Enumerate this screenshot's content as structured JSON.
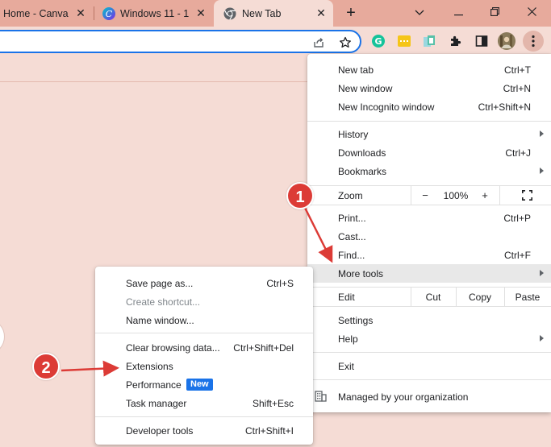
{
  "tabs": [
    {
      "title": "Home - Canva",
      "close": "✕"
    },
    {
      "title": "Windows 11 - 1",
      "close": "✕"
    },
    {
      "title": "New Tab",
      "close": "✕"
    }
  ],
  "new_tab_glyph": "+",
  "window_controls": {
    "chevron": "⌄",
    "minimize": "—",
    "restore": "❐",
    "close": "✕"
  },
  "chrome_menu": {
    "new_tab": {
      "label": "New tab",
      "shortcut": "Ctrl+T"
    },
    "new_window": {
      "label": "New window",
      "shortcut": "Ctrl+N"
    },
    "new_incognito": {
      "label": "New Incognito window",
      "shortcut": "Ctrl+Shift+N"
    },
    "history": {
      "label": "History"
    },
    "downloads": {
      "label": "Downloads",
      "shortcut": "Ctrl+J"
    },
    "bookmarks": {
      "label": "Bookmarks"
    },
    "zoom": {
      "label": "Zoom",
      "minus": "−",
      "value": "100%",
      "plus": "+"
    },
    "print": {
      "label": "Print...",
      "shortcut": "Ctrl+P"
    },
    "cast": {
      "label": "Cast..."
    },
    "find": {
      "label": "Find...",
      "shortcut": "Ctrl+F"
    },
    "more_tools": {
      "label": "More tools"
    },
    "edit": {
      "label": "Edit",
      "cut": "Cut",
      "copy": "Copy",
      "paste": "Paste"
    },
    "settings": {
      "label": "Settings"
    },
    "help": {
      "label": "Help"
    },
    "exit": {
      "label": "Exit"
    },
    "managed": {
      "label": "Managed by your organization"
    }
  },
  "more_tools_menu": {
    "save_page": {
      "label": "Save page as...",
      "shortcut": "Ctrl+S"
    },
    "create_shortcut": {
      "label": "Create shortcut..."
    },
    "name_window": {
      "label": "Name window..."
    },
    "clear_browsing": {
      "label": "Clear browsing data...",
      "shortcut": "Ctrl+Shift+Del"
    },
    "extensions": {
      "label": "Extensions"
    },
    "performance": {
      "label": "Performance",
      "badge": "New"
    },
    "task_manager": {
      "label": "Task manager",
      "shortcut": "Shift+Esc"
    },
    "developer_tools": {
      "label": "Developer tools",
      "shortcut": "Ctrl+Shift+I"
    }
  },
  "markers": {
    "step1": "1",
    "step2": "2"
  },
  "colors": {
    "accent": "#1a73e8",
    "marker": "#dc3b36",
    "tabstrip": "#e7aa9c",
    "page": "#f5dcd5"
  }
}
